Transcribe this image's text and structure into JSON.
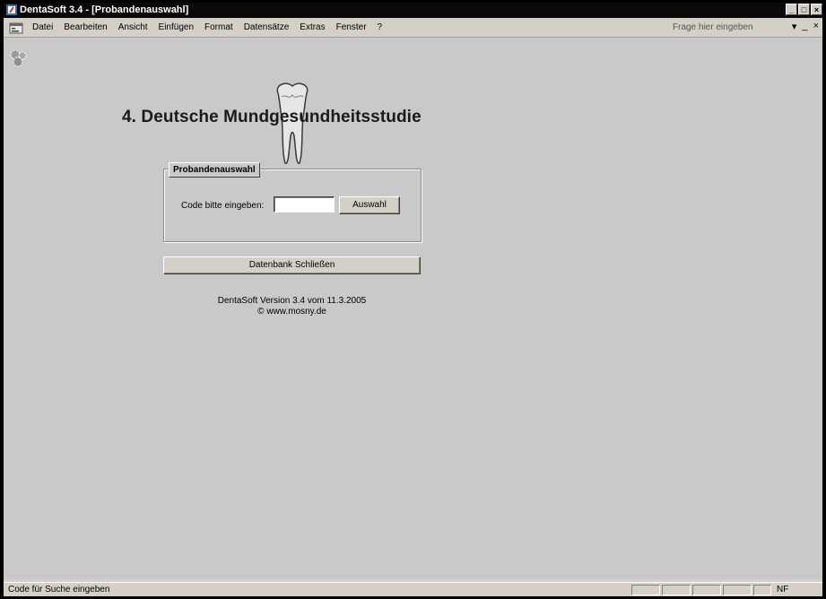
{
  "window": {
    "title": "DentaSoft 3.4 - [Probandenauswahl]",
    "controls": [
      "_",
      "□",
      "×"
    ]
  },
  "menubar": {
    "items": [
      "Datei",
      "Bearbeiten",
      "Ansicht",
      "Einfügen",
      "Format",
      "Datensätze",
      "Extras",
      "Fenster",
      "?"
    ],
    "help_box": "Frage hier eingeben",
    "doc_controls": [
      "▾",
      "_",
      "×"
    ]
  },
  "form": {
    "title": "4. Deutsche Mundgesundheitsstudie",
    "frame_legend": "Probandenauswahl",
    "code_label": "Code bitte eingeben:",
    "code_value": "",
    "select_button": "Auswahl",
    "close_db_button": "Datenbank Schließen",
    "version_line": "DentaSoft Version 3.4 vom 11.3.2005",
    "website_line": "© www.mosny.de"
  },
  "statusbar": {
    "text": "Code für Suche eingeben",
    "indicator": "NF"
  },
  "colors": {
    "titlebar": "#0a0a0a",
    "client_bg": "#c9c9c9",
    "chrome": "#d4d0c8"
  },
  "icons": {
    "app": "dentasoft-app-icon",
    "document": "access-form-icon",
    "form": "gear-cluster-icon",
    "logo": "tooth-icon"
  }
}
